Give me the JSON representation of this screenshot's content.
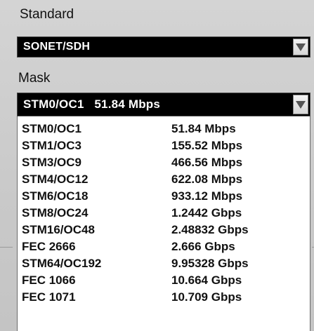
{
  "standard": {
    "label": "Standard",
    "value": "SONET/SDH"
  },
  "mask": {
    "label": "Mask",
    "value": "STM0/OC1   51.84 Mbps",
    "options": [
      {
        "name": "STM0/OC1",
        "rate": "51.84 Mbps"
      },
      {
        "name": "STM1/OC3",
        "rate": "155.52 Mbps"
      },
      {
        "name": "STM3/OC9",
        "rate": "466.56 Mbps"
      },
      {
        "name": "STM4/OC12",
        "rate": "622.08 Mbps"
      },
      {
        "name": "STM6/OC18",
        "rate": "933.12 Mbps"
      },
      {
        "name": "STM8/OC24",
        "rate": "1.2442 Gbps"
      },
      {
        "name": "STM16/OC48",
        "rate": "2.48832 Gbps"
      },
      {
        "name": "FEC 2666",
        "rate": "2.666 Gbps"
      },
      {
        "name": "STM64/OC192",
        "rate": "9.95328 Gbps"
      },
      {
        "name": "FEC 1066",
        "rate": "10.664 Gbps"
      },
      {
        "name": "FEC 1071",
        "rate": "10.709 Gbps"
      }
    ]
  },
  "icons": {
    "dropdown": "chevron-down-icon"
  }
}
